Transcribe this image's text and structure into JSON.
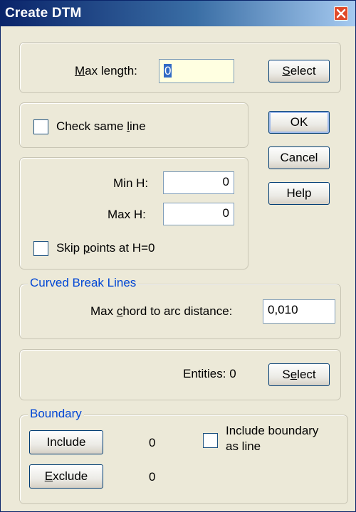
{
  "dialog": {
    "title": "Create DTM",
    "close_icon": "close-x-icon"
  },
  "max_length": {
    "label_prefix": "",
    "label_mnemonic": "M",
    "label_rest": "ax length:",
    "value": "0",
    "select_mnemonic": "S",
    "select_rest": "elect"
  },
  "buttons": {
    "ok": "OK",
    "cancel": "Cancel",
    "help": "Help"
  },
  "check_same_line": {
    "label_pre": "Check same ",
    "label_mnemonic": "l",
    "label_post": "ine",
    "checked": false
  },
  "height": {
    "min_label": "Min H:",
    "min_value": "0",
    "max_label": "Max H:",
    "max_value": "0",
    "skip_pre": "Skip ",
    "skip_mnemonic": "p",
    "skip_post": "oints at H=0",
    "skip_checked": false
  },
  "curved_break_lines": {
    "legend": "Curved Break Lines",
    "label_pre": "Max ",
    "label_mnemonic": "c",
    "label_post": "hord to arc distance:",
    "value": "0,010"
  },
  "entities": {
    "label": "Entities: 0",
    "select_pre": "S",
    "select_mnemonic": "e",
    "select_post": "lect"
  },
  "boundary": {
    "legend": "Boundary",
    "include_label": "Include",
    "include_count": "0",
    "exclude_mnemonic": "E",
    "exclude_rest": "xclude",
    "exclude_count": "0",
    "as_line_label_1": "Include boundary",
    "as_line_label_2": "as line",
    "as_line_checked": false
  }
}
